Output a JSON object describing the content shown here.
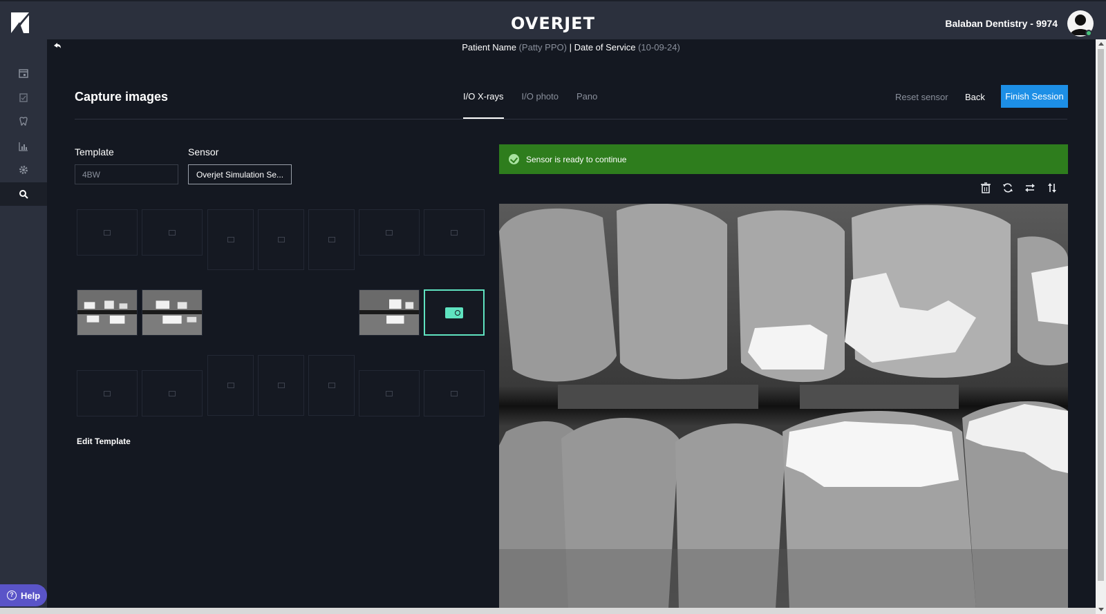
{
  "app": {
    "brand": "OVERJET",
    "practice": "Balaban Dentistry - 9974"
  },
  "sidebar": {
    "items": [
      {
        "id": "calendar",
        "icon": "calendar-icon"
      },
      {
        "id": "clipboard",
        "icon": "clipboard-icon"
      },
      {
        "id": "tooth",
        "icon": "tooth-icon"
      },
      {
        "id": "analytics",
        "icon": "bar-chart-icon"
      },
      {
        "id": "settings",
        "icon": "gear-icon"
      },
      {
        "id": "search",
        "icon": "search-icon",
        "active": true
      }
    ],
    "help_label": "Help"
  },
  "patient": {
    "name_label": "Patient Name",
    "name_value": "(Patty PPO)",
    "separator": "|",
    "dos_label": "Date of Service",
    "dos_value": "(10-09-24)"
  },
  "page": {
    "title": "Capture images",
    "tabs": [
      {
        "label": "I/O X-rays",
        "active": true
      },
      {
        "label": "I/O photo",
        "active": false
      },
      {
        "label": "Pano",
        "active": false
      }
    ],
    "reset_label": "Reset sensor",
    "back_label": "Back",
    "finish_label": "Finish Session"
  },
  "form": {
    "template_label": "Template",
    "template_value": "4BW",
    "sensor_label": "Sensor",
    "sensor_value": "Overjet Simulation Se..."
  },
  "grid": {
    "edit_template_label": "Edit Template"
  },
  "status": {
    "message": "Sensor is ready to continue",
    "color": "#2e7d1d"
  },
  "tools": [
    "trash-icon",
    "rotate-icon",
    "flip-horizontal-icon",
    "flip-vertical-icon"
  ],
  "colors": {
    "accent": "#1d8fe6",
    "active_slot": "#5fe3c0",
    "help": "#5a54c8"
  }
}
